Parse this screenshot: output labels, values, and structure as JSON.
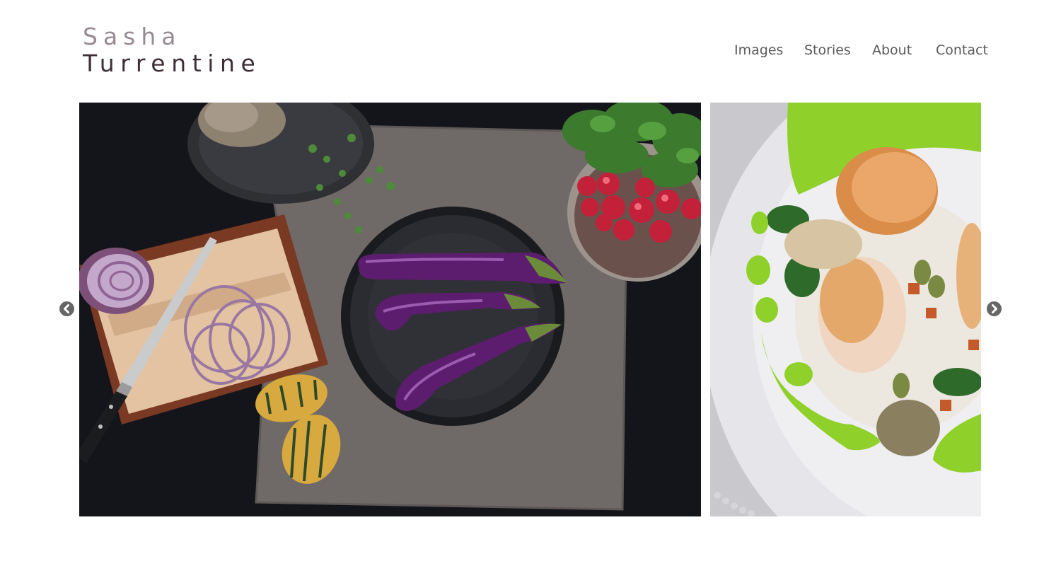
{
  "site": {
    "title_first": "Sasha",
    "title_last": "Turrentine"
  },
  "nav": {
    "items": [
      {
        "label": "Images"
      },
      {
        "label": "Stories"
      },
      {
        "label": "About"
      },
      {
        "label": "Contact"
      }
    ]
  },
  "gallery": {
    "photos": [
      {
        "subject": "overhead still life: eggplants on black plate, knife, red onion, radishes, squash on linen"
      },
      {
        "subject": "seared scallops on white plate with green herb oil"
      }
    ],
    "prev_icon": "chevron-left-circle",
    "next_icon": "chevron-right-circle"
  },
  "colors": {
    "title_first": "#968b93",
    "title_last": "#3f2e38",
    "nav_text": "#5a5a5a",
    "arrow": "#666666"
  }
}
